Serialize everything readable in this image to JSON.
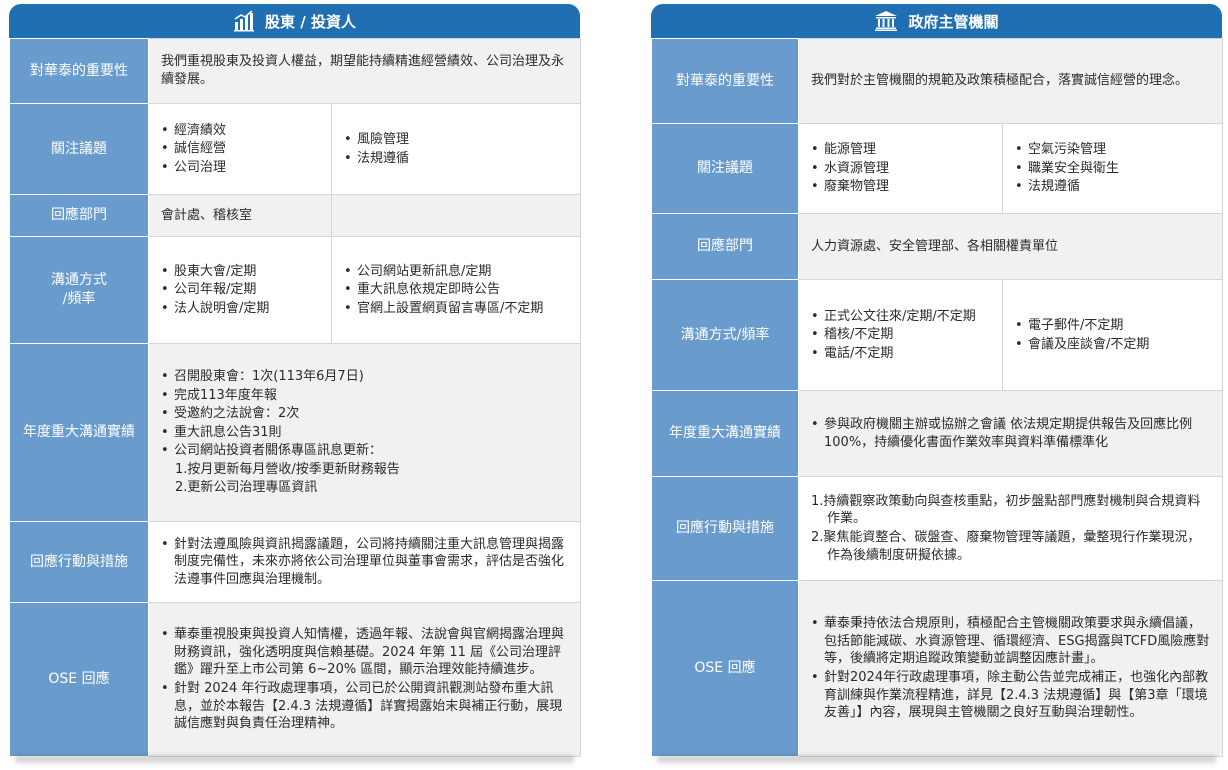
{
  "left": {
    "title": "股東 / 投資人",
    "rows": {
      "importance": {
        "label": "對華泰的重要性",
        "text": "我們重視股東及投資人權益，期望能持續精進經營績效、公司治理及永續發展。"
      },
      "topics": {
        "label": "關注議題",
        "col1": [
          "經濟績效",
          "誠信經營",
          "公司治理"
        ],
        "col2": [
          "風險管理",
          "法規遵循"
        ]
      },
      "dept": {
        "label": "回應部門",
        "text": "會計處、稽核室"
      },
      "channel": {
        "label1": "溝通方式",
        "label2": "/頻率",
        "col1": [
          "股東大會/定期",
          "公司年報/定期",
          "法人說明會/定期"
        ],
        "col2": [
          "公司網站更新訊息/定期",
          "重大訊息依規定即時公告",
          "官網上設置網頁留言專區/不定期"
        ]
      },
      "annual": {
        "label": "年度重大溝通實績",
        "items": [
          "召開股東會：1次(113年6月7日)",
          "完成113年度年報",
          "受邀約之法說會：2次",
          "重大訊息公告31則",
          "公司網站投資者關係專區訊息更新："
        ],
        "subitems": [
          "1.按月更新每月營收/按季更新財務報告",
          "2.更新公司治理專區資訊"
        ]
      },
      "action": {
        "label": "回應行動與措施",
        "items": [
          "針對法遵風險與資訊揭露議題，公司將持續關注重大訊息管理與揭露制度完備性，未來亦將依公司治理單位與董事會需求，評估是否強化法遵事件回應與治理機制。"
        ]
      },
      "ose": {
        "label": "OSE 回應",
        "items": [
          "華泰重視股東與投資人知情權，透過年報、法說會與官網揭露治理與財務資訊，強化透明度與信賴基礎。2024 年第 11 屆《公司治理評鑑》躍升至上市公司第 6~20% 區間，顯示治理效能持續進步。",
          "針對 2024 年行政處理事項，公司已於公開資訊觀測站發布重大訊息，並於本報告【2.4.3 法規遵循】詳實揭露始末與補正行動，展現誠信應對與負責任治理精神。"
        ]
      }
    }
  },
  "right": {
    "title": "政府主管機關",
    "rows": {
      "importance": {
        "label": "對華泰的重要性",
        "text": "我們對於主管機關的規範及政策積極配合，落實誠信經營的理念。"
      },
      "topics": {
        "label": "關注議題",
        "col1": [
          "能源管理",
          "水資源管理",
          "廢棄物管理"
        ],
        "col2": [
          "空氣污染管理",
          "職業安全與衛生",
          "法規遵循"
        ]
      },
      "dept": {
        "label": "回應部門",
        "text": "人力資源處、安全管理部、各相關權責單位"
      },
      "channel": {
        "label": "溝通方式/頻率",
        "col1": [
          "正式公文往來/定期/不定期",
          "稽核/不定期",
          "電話/不定期"
        ],
        "col2": [
          "電子郵件/不定期",
          "會議及座談會/不定期"
        ]
      },
      "annual": {
        "label": "年度重大溝通實績",
        "items": [
          "參與政府機關主辦或協辦之會議 依法規定期提供報告及回應比例100%，持續優化書面作業效率與資料準備標準化"
        ]
      },
      "action": {
        "label": "回應行動與措施",
        "items": [
          "1.持續觀察政策動向與查核重點，初步盤點部門應對機制與合規資料作業。",
          "2.聚焦能資整合、碳盤查、廢棄物管理等議題，彙整現行作業現況，作為後續制度研擬依據。"
        ]
      },
      "ose": {
        "label": "OSE 回應",
        "items": [
          "華泰秉持依法合規原則，積極配合主管機關政策要求與永續倡議，包括節能減碳、水資源管理、循環經濟、ESG揭露與TCFD風險應對等，後續將定期追蹤政策變動並調整因應計畫」。",
          "針對2024年行政處理事項，除主動公告並完成補正，也強化內部教育訓練與作業流程精進，詳見【2.4.3 法規遵循】與【第3章「環境友善」】內容，展現與主管機關之良好互動與治理韌性。"
        ]
      }
    }
  }
}
